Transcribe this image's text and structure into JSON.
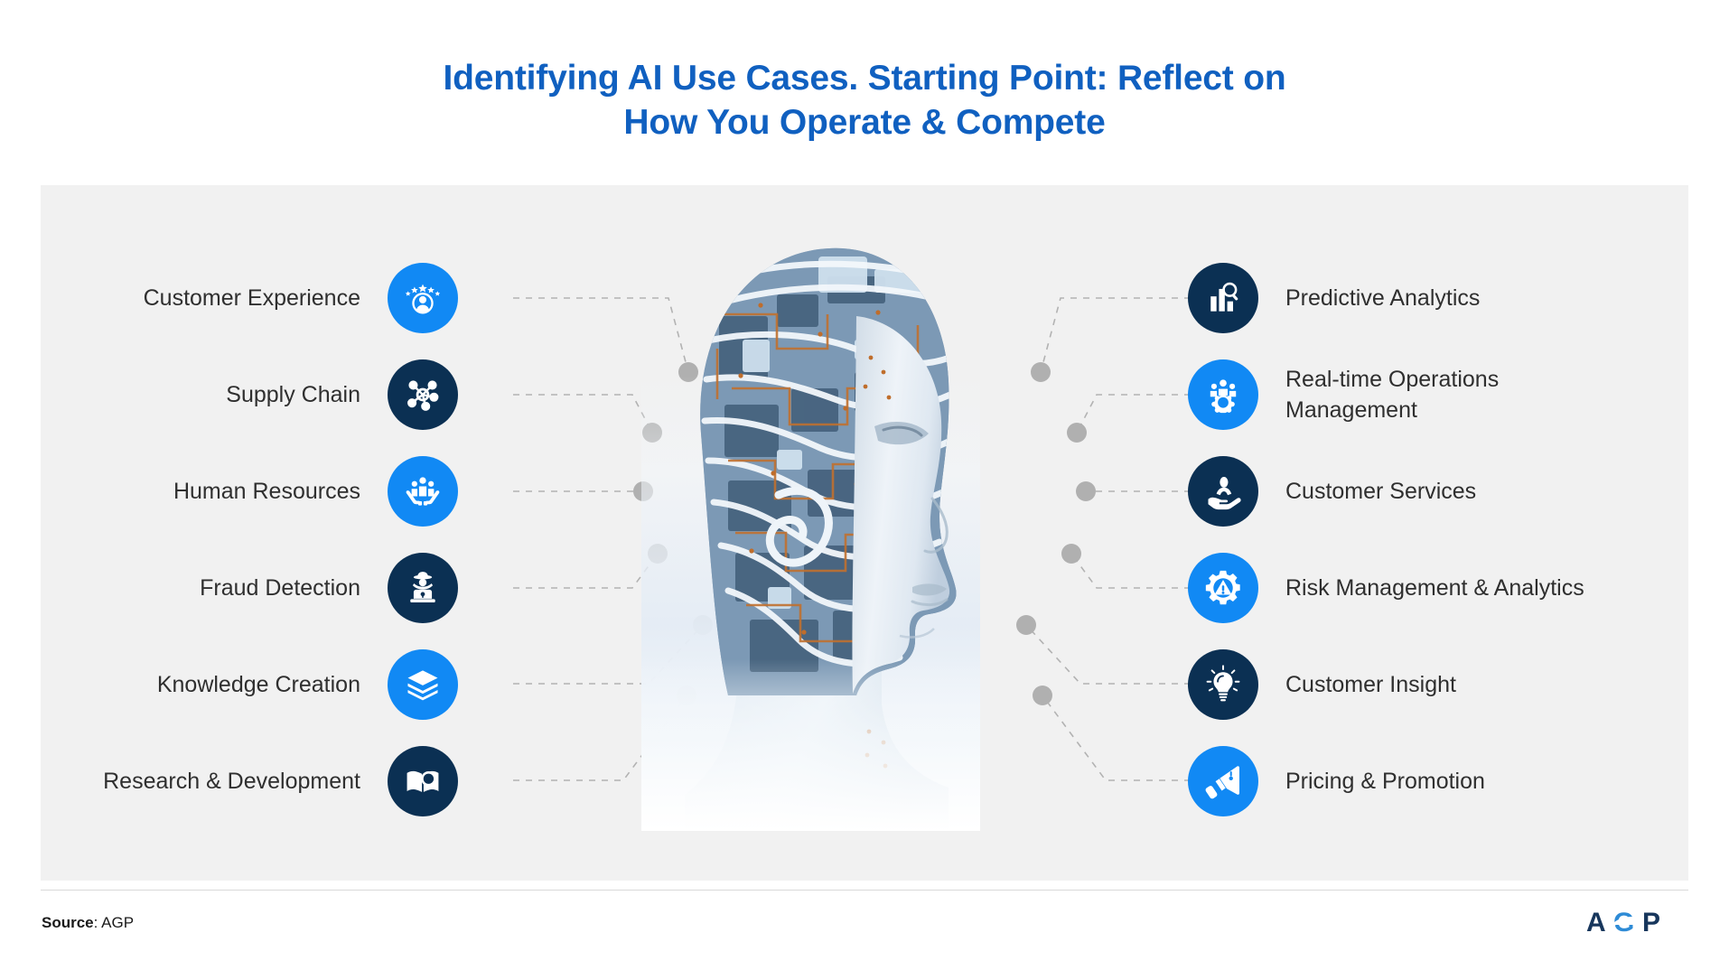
{
  "title": "Identifying AI Use Cases. Starting Point: Reflect on\nHow You Operate & Compete",
  "title_line1": "Identifying AI Use Cases. Starting Point: Reflect on",
  "title_line2": "How You Operate & Compete",
  "colors": {
    "title_blue": "#1060c0",
    "icon_blue": "#1189f4",
    "icon_navy": "#0b3053",
    "panel_bg": "#f1f1f1",
    "label_text": "#2f2f2f",
    "connector_gray": "#b2b2b2",
    "page_bg": "#ffffff"
  },
  "center_image": {
    "name": "ai-robot-head-circuitry",
    "description": "Profile of a robotic human head with exposed circuitry and wiring"
  },
  "left_column": [
    {
      "label": "Customer Experience",
      "icon": "customer-experience-icon",
      "icon_color": "blue"
    },
    {
      "label": "Supply Chain",
      "icon": "supply-chain-network-icon",
      "icon_color": "navy"
    },
    {
      "label": "Human Resources",
      "icon": "human-resources-icon",
      "icon_color": "blue"
    },
    {
      "label": "Fraud Detection",
      "icon": "fraud-detection-icon",
      "icon_color": "navy"
    },
    {
      "label": "Knowledge Creation",
      "icon": "knowledge-books-icon",
      "icon_color": "blue"
    },
    {
      "label": "Research & Development",
      "icon": "research-book-search-icon",
      "icon_color": "navy"
    }
  ],
  "right_column": [
    {
      "label": "Predictive Analytics",
      "icon": "predictive-analytics-icon",
      "icon_color": "navy"
    },
    {
      "label": "Real-time Operations\nManagement",
      "icon": "operations-management-icon",
      "icon_color": "blue"
    },
    {
      "label": "Customer Services",
      "icon": "customer-services-icon",
      "icon_color": "navy"
    },
    {
      "label": "Risk Management & Analytics",
      "icon": "risk-management-gear-icon",
      "icon_color": "blue"
    },
    {
      "label": "Customer Insight",
      "icon": "lightbulb-insight-icon",
      "icon_color": "navy"
    },
    {
      "label": "Pricing & Promotion",
      "icon": "megaphone-promotion-icon",
      "icon_color": "blue"
    }
  ],
  "footer": {
    "source_label": "Source",
    "source_separator": ": ",
    "source_value": "AGP",
    "logo_text": "AGP"
  }
}
